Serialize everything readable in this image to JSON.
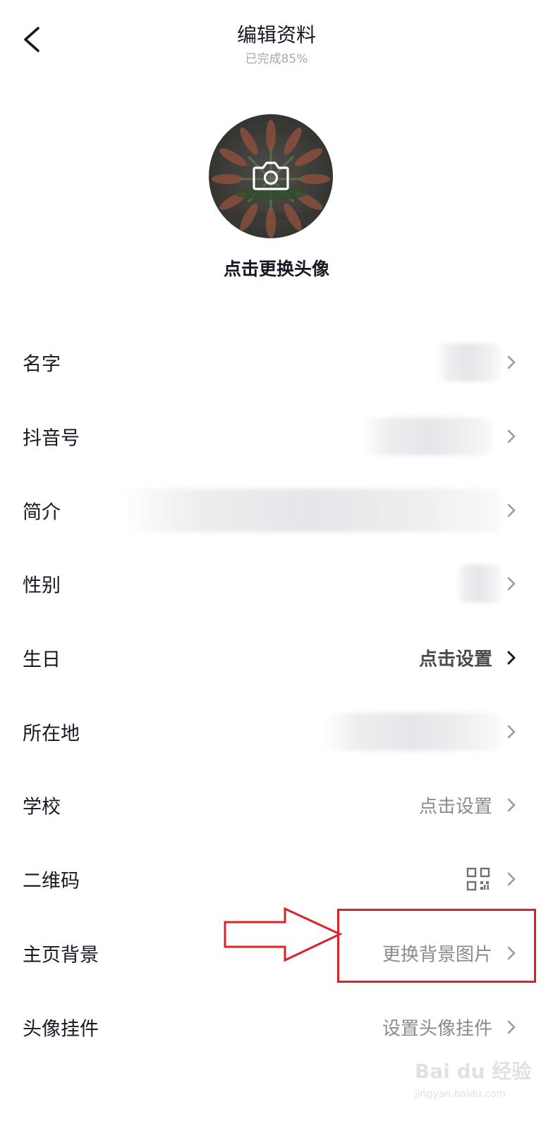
{
  "header": {
    "title": "编辑资料",
    "completion": "已完成85%"
  },
  "avatar": {
    "change_label": "点击更换头像"
  },
  "rows": [
    {
      "label": "名字",
      "value": null,
      "value_kind": "blurred"
    },
    {
      "label": "抖音号",
      "value": null,
      "value_kind": "blurred"
    },
    {
      "label": "简介",
      "value": null,
      "value_kind": "blurred"
    },
    {
      "label": "性别",
      "value": null,
      "value_kind": "blurred"
    },
    {
      "label": "生日",
      "value": "点击设置",
      "value_kind": "text-emphasis"
    },
    {
      "label": "所在地",
      "value": null,
      "value_kind": "blurred"
    },
    {
      "label": "学校",
      "value": "点击设置",
      "value_kind": "text"
    },
    {
      "label": "二维码",
      "value": null,
      "value_kind": "qr-icon"
    },
    {
      "label": "主页背景",
      "value": "更换背景图片",
      "value_kind": "text"
    },
    {
      "label": "头像挂件",
      "value": "设置头像挂件",
      "value_kind": "text"
    }
  ],
  "icons": {
    "back": "chevron-left-icon",
    "camera": "camera-icon",
    "row_arrow": "chevron-right-icon",
    "qr": "qr-code-icon"
  },
  "colors": {
    "text_primary": "#161823",
    "text_secondary": "#8a8b91",
    "annotation": "#d8232a"
  },
  "watermark": {
    "logo": "Bai du 经验",
    "url": "jingyan.baidu.com"
  }
}
